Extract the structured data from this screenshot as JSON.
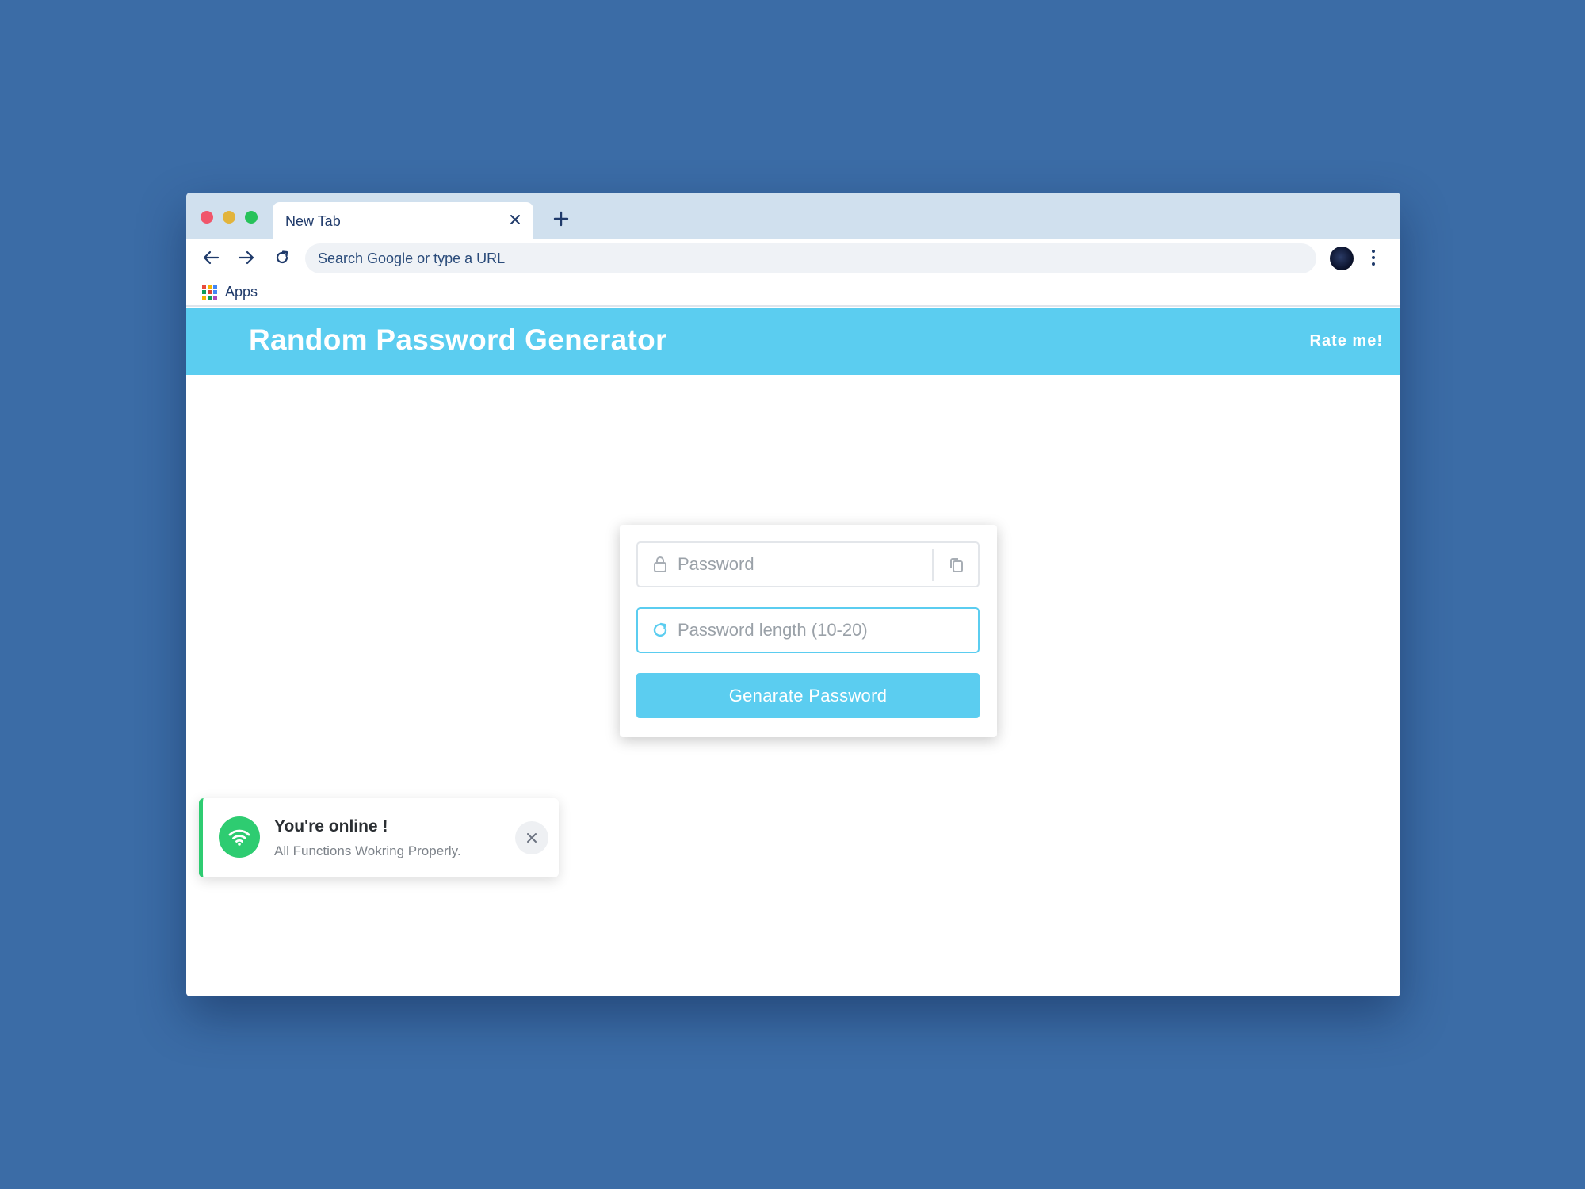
{
  "colors": {
    "desktop_background": "#3b6ca6",
    "tab_strip": "#d0e0ee",
    "accent": "#5bcdf0",
    "online_green": "#2ecc71",
    "traffic_red": "#f0566b",
    "traffic_yellow": "#e2b43c",
    "traffic_green": "#27c25a"
  },
  "browser": {
    "tab": {
      "title": "New Tab",
      "close_icon": "close-icon"
    },
    "new_tab_icon": "plus-icon",
    "toolbar": {
      "back_icon": "arrow-left-icon",
      "forward_icon": "arrow-right-icon",
      "reload_icon": "reload-icon",
      "omnibox_placeholder": "Search Google or type a URL",
      "omnibox_value": "",
      "menu_icon": "more-vert-icon"
    },
    "bookmarks": {
      "apps_label": "Apps",
      "apps_icon": "apps-grid-icon"
    }
  },
  "app": {
    "header": {
      "title": "Random Password Generator",
      "rate_link": "Rate me!"
    },
    "form": {
      "password_placeholder": "Password",
      "password_value": "",
      "password_icon": "lock-icon",
      "copy_icon": "copy-icon",
      "length_placeholder": "Password length (10-20)",
      "length_value": "",
      "length_icon": "refresh-icon",
      "generate_button": "Genarate Password"
    },
    "toast": {
      "icon": "wifi-icon",
      "title": "You're online !",
      "message": "All Functions Wokring Properly.",
      "close_icon": "close-icon"
    }
  }
}
